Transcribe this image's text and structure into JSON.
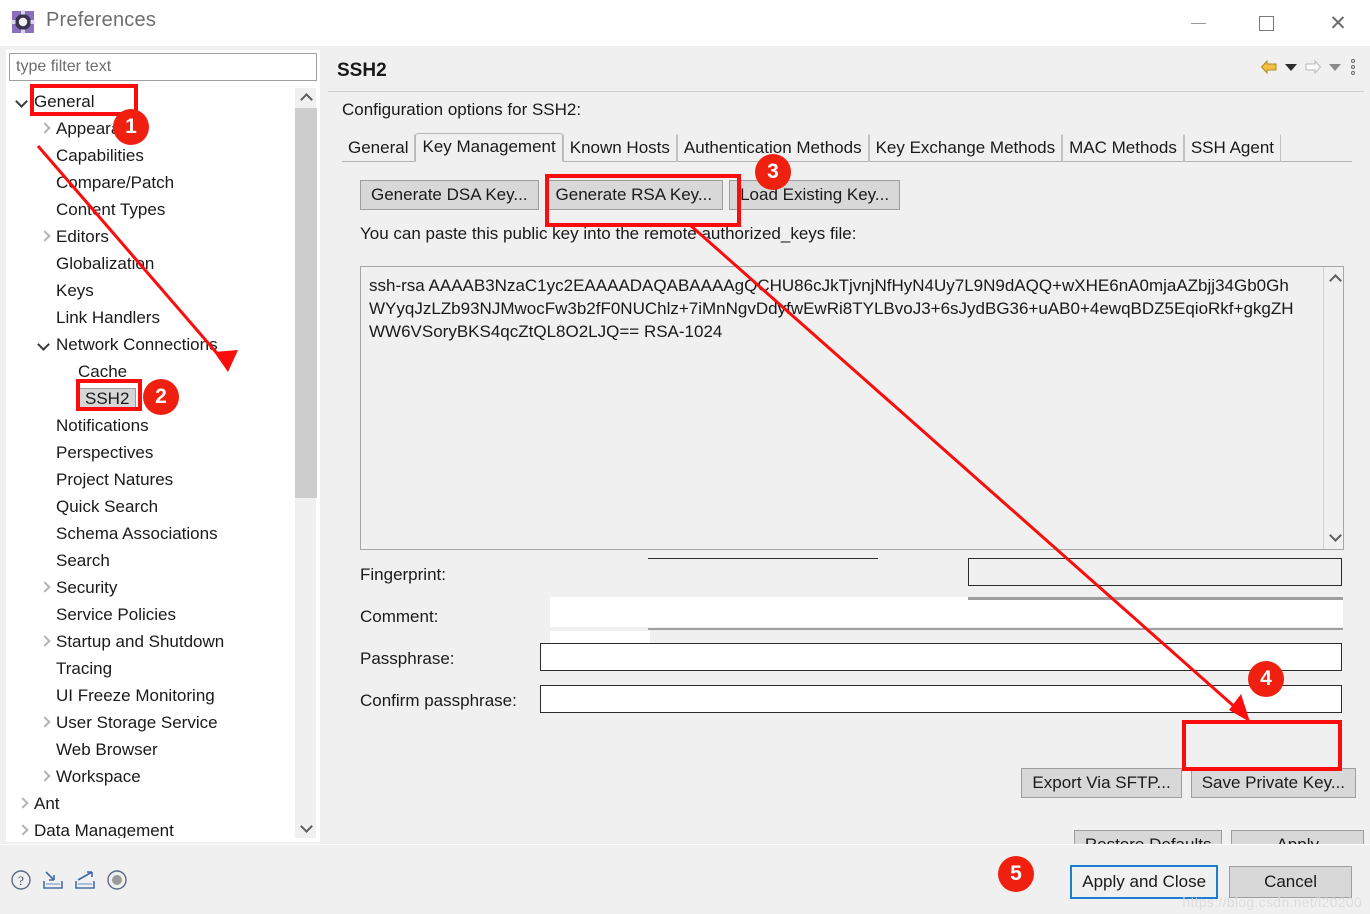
{
  "window": {
    "title": "Preferences",
    "icon": "preferences-gear-icon",
    "minimize": "minimize-icon",
    "maximize": "maximize-icon",
    "close": "close-icon"
  },
  "colors": {
    "accent_red": "#fb0d0d",
    "badge_red": "#f02010",
    "focus_blue": "#1a7fd4",
    "panel_bg": "#f0f0f0",
    "button_bg": "#d8d8d8"
  },
  "sidebar": {
    "filter_placeholder": "type filter text",
    "filter_value": "",
    "items": [
      {
        "label": "General",
        "indent": 0,
        "arrow": "down",
        "selected": false,
        "highlight": true
      },
      {
        "label": "Appearance",
        "indent": 1,
        "arrow": "right",
        "selected": false,
        "highlight": false
      },
      {
        "label": "Capabilities",
        "indent": 1,
        "arrow": "none",
        "selected": false,
        "highlight": false
      },
      {
        "label": "Compare/Patch",
        "indent": 1,
        "arrow": "none",
        "selected": false,
        "highlight": false
      },
      {
        "label": "Content Types",
        "indent": 1,
        "arrow": "none",
        "selected": false,
        "highlight": false
      },
      {
        "label": "Editors",
        "indent": 1,
        "arrow": "right",
        "selected": false,
        "highlight": false
      },
      {
        "label": "Globalization",
        "indent": 1,
        "arrow": "none",
        "selected": false,
        "highlight": false
      },
      {
        "label": "Keys",
        "indent": 1,
        "arrow": "none",
        "selected": false,
        "highlight": false
      },
      {
        "label": "Link Handlers",
        "indent": 1,
        "arrow": "none",
        "selected": false,
        "highlight": false
      },
      {
        "label": "Network Connections",
        "indent": 1,
        "arrow": "down",
        "selected": false,
        "highlight": false
      },
      {
        "label": "Cache",
        "indent": 2,
        "arrow": "none",
        "selected": false,
        "highlight": false
      },
      {
        "label": "SSH2",
        "indent": 2,
        "arrow": "none",
        "selected": true,
        "highlight": true
      },
      {
        "label": "Notifications",
        "indent": 1,
        "arrow": "none",
        "selected": false,
        "highlight": false
      },
      {
        "label": "Perspectives",
        "indent": 1,
        "arrow": "none",
        "selected": false,
        "highlight": false
      },
      {
        "label": "Project Natures",
        "indent": 1,
        "arrow": "none",
        "selected": false,
        "highlight": false
      },
      {
        "label": "Quick Search",
        "indent": 1,
        "arrow": "none",
        "selected": false,
        "highlight": false
      },
      {
        "label": "Schema Associations",
        "indent": 1,
        "arrow": "none",
        "selected": false,
        "highlight": false
      },
      {
        "label": "Search",
        "indent": 1,
        "arrow": "none",
        "selected": false,
        "highlight": false
      },
      {
        "label": "Security",
        "indent": 1,
        "arrow": "right",
        "selected": false,
        "highlight": false
      },
      {
        "label": "Service Policies",
        "indent": 1,
        "arrow": "none",
        "selected": false,
        "highlight": false
      },
      {
        "label": "Startup and Shutdown",
        "indent": 1,
        "arrow": "right",
        "selected": false,
        "highlight": false
      },
      {
        "label": "Tracing",
        "indent": 1,
        "arrow": "none",
        "selected": false,
        "highlight": false
      },
      {
        "label": "UI Freeze Monitoring",
        "indent": 1,
        "arrow": "none",
        "selected": false,
        "highlight": false
      },
      {
        "label": "User Storage Service",
        "indent": 1,
        "arrow": "right",
        "selected": false,
        "highlight": false
      },
      {
        "label": "Web Browser",
        "indent": 1,
        "arrow": "none",
        "selected": false,
        "highlight": false
      },
      {
        "label": "Workspace",
        "indent": 1,
        "arrow": "right",
        "selected": false,
        "highlight": false
      },
      {
        "label": "Ant",
        "indent": 0,
        "arrow": "right",
        "selected": false,
        "highlight": false
      },
      {
        "label": "Data Management",
        "indent": 0,
        "arrow": "right",
        "selected": false,
        "highlight": false
      }
    ],
    "scroll_up_icon": "chevron-up-icon",
    "scroll_down_icon": "chevron-down-icon"
  },
  "page": {
    "title": "SSH2",
    "description": "Configuration options for SSH2:",
    "nav": {
      "back_icon": "arrow-left-icon",
      "back_menu_icon": "chevron-down-icon",
      "forward_icon": "arrow-right-icon",
      "forward_menu_icon": "chevron-down-icon",
      "view_menu_icon": "vertical-dots-icon"
    },
    "tabs": [
      {
        "label": "General",
        "active": false
      },
      {
        "label": "Key Management",
        "active": true
      },
      {
        "label": "Known Hosts",
        "active": false
      },
      {
        "label": "Authentication Methods",
        "active": false
      },
      {
        "label": "Key Exchange Methods",
        "active": false
      },
      {
        "label": "MAC Methods",
        "active": false
      },
      {
        "label": "SSH Agent",
        "active": false
      }
    ],
    "key_buttons": [
      {
        "label": "Generate DSA Key...",
        "highlighted": false
      },
      {
        "label": "Generate RSA Key...",
        "highlighted": true
      },
      {
        "label": "Load Existing Key...",
        "highlighted": false
      }
    ],
    "paste_hint": "You can paste this public key into the remote authorized_keys file:",
    "public_key": "ssh-rsa AAAAB3NzaC1yc2EAAAADAQABAAAAgQCHU86cJkTjvnjNfHyN4Uy7L9N9dAQQ+wXHE6nA0mjaAZbjj34Gb0GhWYyqJzLZb93NJMwocFw3b2fF0NUChlz+7iMnNgvDdyfwEwRi8TYLBvoJ3+6sJydBG36+uAB0+4ewqBDZ5EqioRkf+gkgZHWW6VSoryBKS4qcZtQL8O2LJQ== RSA-1024",
    "key_scroll_up_icon": "chevron-up-icon",
    "key_scroll_down_icon": "chevron-down-icon",
    "fields": [
      {
        "label": "Fingerprint:",
        "value": "",
        "name": "fingerprint"
      },
      {
        "label": "Comment:",
        "value": "",
        "name": "comment"
      },
      {
        "label": "Passphrase:",
        "value": "",
        "name": "passphrase"
      },
      {
        "label": "Confirm passphrase:",
        "value": "",
        "name": "confirm-passphrase"
      }
    ],
    "export_button": "Export Via SFTP...",
    "save_private_key_button": "Save Private Key...",
    "restore_defaults_button": "Restore Defaults",
    "apply_button": "Apply"
  },
  "footer": {
    "icons": [
      {
        "name": "help-icon"
      },
      {
        "name": "import-icon"
      },
      {
        "name": "export-icon"
      },
      {
        "name": "record-icon"
      }
    ],
    "apply_and_close": "Apply and Close",
    "cancel": "Cancel",
    "watermark": "https://blog.csdn.net/l20200"
  },
  "annotations": {
    "badges": [
      {
        "number": "1",
        "target": "general-tree-item"
      },
      {
        "number": "2",
        "target": "ssh2-tree-item"
      },
      {
        "number": "3",
        "target": "generate-rsa-key-button"
      },
      {
        "number": "4",
        "target": "save-private-key-button"
      },
      {
        "number": "5",
        "target": "apply-and-close-button"
      }
    ]
  }
}
